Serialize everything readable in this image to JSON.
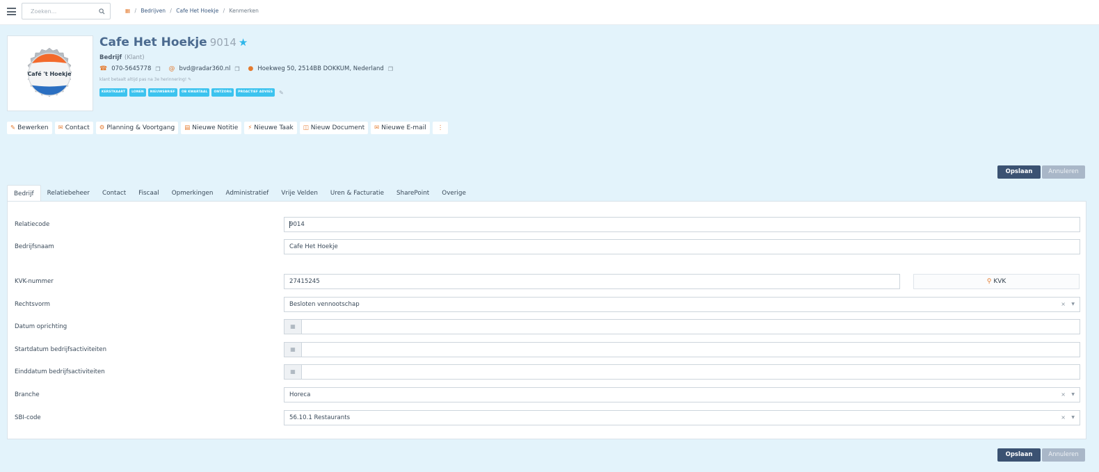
{
  "search": {
    "placeholder": "Zoeken..."
  },
  "breadcrumb": {
    "items": [
      "Bedrijven",
      "Cafe Het Hoekje",
      "Kenmerken"
    ]
  },
  "company": {
    "name": "Cafe Het Hoekje",
    "code": "9014",
    "type": "Bedrijf",
    "type_note": "(Klant)",
    "logo_text": "Café 't Hoekje",
    "phone": "070-5645778",
    "email": "bvd@radar360.nl",
    "address": "Hoekweg 50, 2514BB DOKKUM, Nederland",
    "note": "klant betaalt altijd pas na 3e herinnering!",
    "tags": [
      "KERSTKAART",
      "LONEN",
      "NIEUWSBRIEF",
      "OB KWARTAAL",
      "ONTZORG",
      "PROACTIEF ADVIES"
    ]
  },
  "actions": [
    "Bewerken",
    "Contact",
    "Planning & Voortgang",
    "Nieuwe Notitie",
    "Nieuwe Taak",
    "Nieuw Document",
    "Nieuwe E-mail"
  ],
  "buttons": {
    "save": "Opslaan",
    "cancel": "Annuleren"
  },
  "tabs": [
    "Bedrijf",
    "Relatiebeheer",
    "Contact",
    "Fiscaal",
    "Opmerkingen",
    "Administratief",
    "Vrije Velden",
    "Uren & Facturatie",
    "SharePoint",
    "Overige"
  ],
  "form": {
    "relatiecode": {
      "label": "Relatiecode",
      "value": "9014"
    },
    "bedrijfsnaam": {
      "label": "Bedrijfsnaam",
      "value": "Cafe Het Hoekje"
    },
    "kvk": {
      "label": "KVK-nummer",
      "value": "27415245",
      "button": "KVK"
    },
    "rechtsvorm": {
      "label": "Rechtsvorm",
      "value": "Besloten vennootschap"
    },
    "datum_oprichting": {
      "label": "Datum oprichting",
      "value": ""
    },
    "startdatum": {
      "label": "Startdatum bedrijfsactiviteiten",
      "value": ""
    },
    "einddatum": {
      "label": "Einddatum bedrijfsactiviteiten",
      "value": ""
    },
    "branche": {
      "label": "Branche",
      "value": "Horeca"
    },
    "sbi": {
      "label": "SBI-code",
      "value": "56.10.1 Restaurants"
    }
  },
  "colors": {
    "accent": "#e47a2e",
    "primary": "#3b5272",
    "tag": "#3cc3ef",
    "background": "#e3f3fb"
  }
}
